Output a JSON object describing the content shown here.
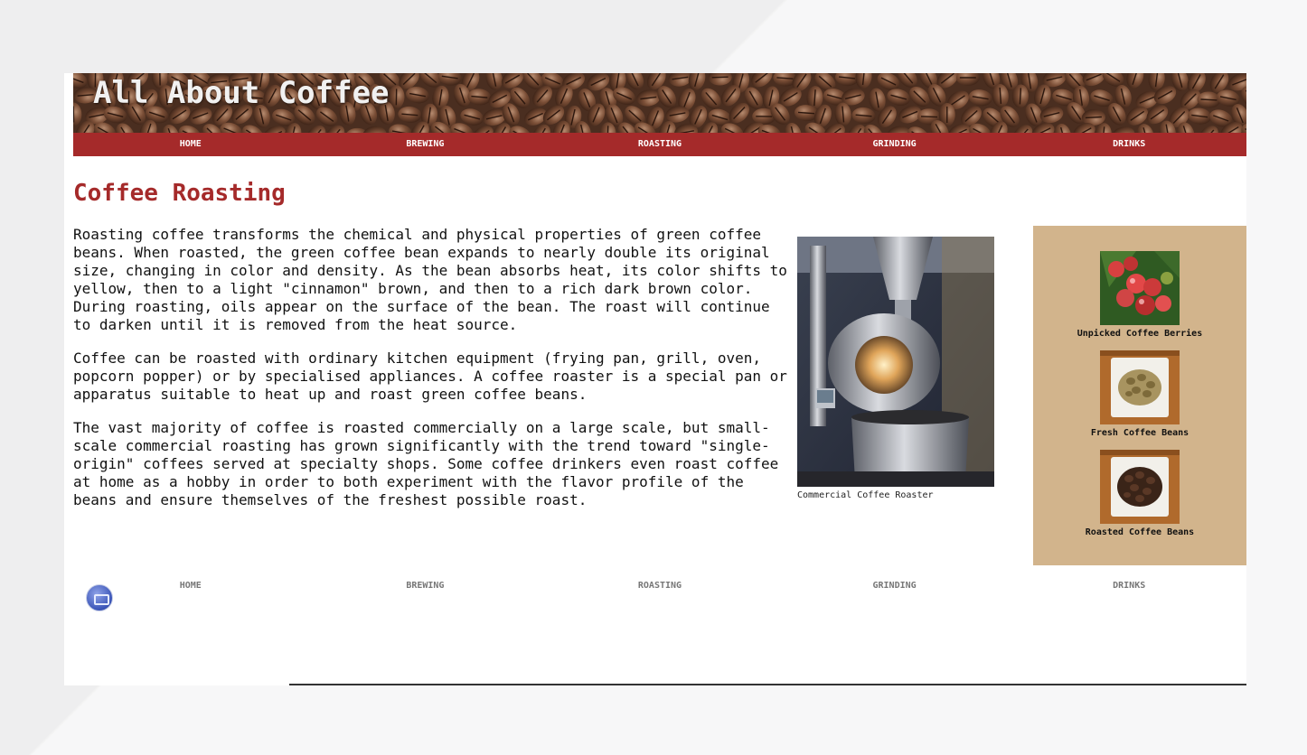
{
  "site": {
    "title": "All About Coffee"
  },
  "nav": {
    "items": [
      "HOME",
      "BREWING",
      "ROASTING",
      "GRINDING",
      "DRINKS"
    ]
  },
  "main": {
    "heading": "Coffee Roasting",
    "paragraphs": [
      "Roasting coffee transforms the chemical and physical properties of green coffee beans. When roasted, the green coffee bean expands to nearly double its original size, changing in color and density. As the bean absorbs heat, its color shifts to yellow, then to a light \"cinnamon\" brown, and then to a rich dark brown color. During roasting, oils appear on the surface of the bean. The roast will continue to darken until it is removed from the heat source.",
      "Coffee can be roasted with ordinary kitchen equipment (frying pan, grill, oven, popcorn popper) or by specialised appliances. A coffee roaster is a special pan or apparatus suitable to heat up and roast green coffee beans.",
      "The vast majority of coffee is roasted commercially on a large scale, but small-scale commercial roasting has grown significantly with the trend toward \"single-origin\" coffees served at specialty shops. Some coffee drinkers even roast coffee at home as a hobby in order to both experiment with the flavor profile of the beans and ensure themselves of the freshest possible roast."
    ],
    "figure_caption": "Commercial Coffee Roaster"
  },
  "sidebar": {
    "items": [
      {
        "label": "Unpicked Coffee Berries"
      },
      {
        "label": "Fresh Coffee Beans"
      },
      {
        "label": "Roasted Coffee Beans"
      }
    ]
  },
  "footer": {
    "nav_items": [
      "HOME",
      "BREWING",
      "ROASTING",
      "GRINDING",
      "DRINKS"
    ],
    "icon": "badge-icon"
  },
  "colors": {
    "accent": "#a52a2a",
    "sidebar_bg": "#d2b48c"
  }
}
